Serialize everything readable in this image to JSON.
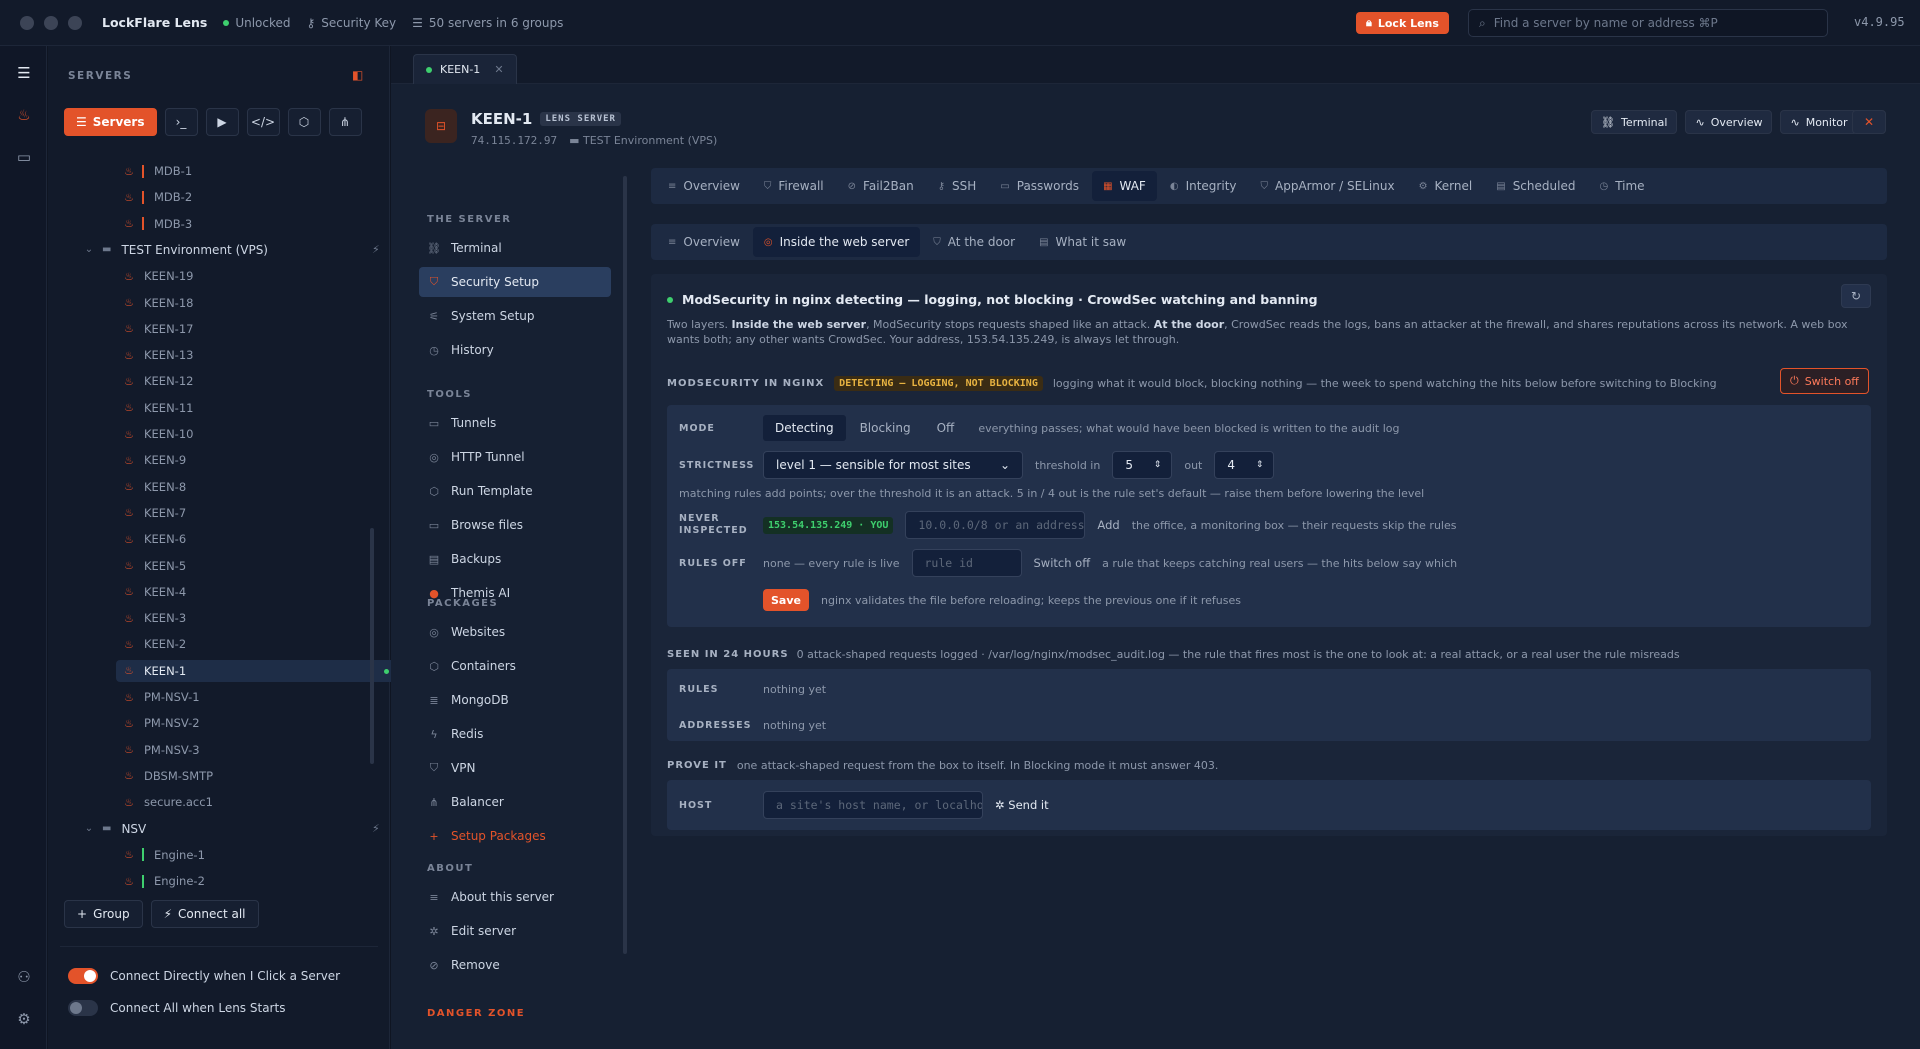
{
  "titlebar": {
    "app_name": "LockFlare Lens",
    "status": "Unlocked",
    "security_key": "Security Key",
    "servers_count": "50 servers in 6 groups",
    "lock_button": "Lock Lens",
    "search_placeholder": "Find a server by name or address ⌘P",
    "version": "v4.9.95"
  },
  "sidebar": {
    "heading": "SERVERS",
    "servers_button": "Servers",
    "group_button": "Group",
    "connect_all_button": "Connect all",
    "toggle_connect_direct": "Connect Directly when I Click a Server",
    "toggle_connect_all": "Connect All when Lens Starts",
    "toggle_connect_direct_on": true,
    "toggle_connect_all_on": false,
    "tree": [
      {
        "type": "server",
        "name": "MDB-1",
        "bar": "red"
      },
      {
        "type": "server",
        "name": "MDB-2",
        "bar": "red"
      },
      {
        "type": "server",
        "name": "MDB-3",
        "bar": "red"
      },
      {
        "type": "group",
        "name": "TEST Environment (VPS)"
      },
      {
        "type": "server",
        "name": "KEEN-19"
      },
      {
        "type": "server",
        "name": "KEEN-18"
      },
      {
        "type": "server",
        "name": "KEEN-17"
      },
      {
        "type": "server",
        "name": "KEEN-13"
      },
      {
        "type": "server",
        "name": "KEEN-12"
      },
      {
        "type": "server",
        "name": "KEEN-11"
      },
      {
        "type": "server",
        "name": "KEEN-10"
      },
      {
        "type": "server",
        "name": "KEEN-9"
      },
      {
        "type": "server",
        "name": "KEEN-8"
      },
      {
        "type": "server",
        "name": "KEEN-7"
      },
      {
        "type": "server",
        "name": "KEEN-6"
      },
      {
        "type": "server",
        "name": "KEEN-5"
      },
      {
        "type": "server",
        "name": "KEEN-4"
      },
      {
        "type": "server",
        "name": "KEEN-3"
      },
      {
        "type": "server",
        "name": "KEEN-2"
      },
      {
        "type": "server",
        "name": "KEEN-1",
        "active": true
      },
      {
        "type": "server",
        "name": "PM-NSV-1"
      },
      {
        "type": "server",
        "name": "PM-NSV-2"
      },
      {
        "type": "server",
        "name": "PM-NSV-3"
      },
      {
        "type": "server",
        "name": "DBSM-SMTP"
      },
      {
        "type": "server",
        "name": "secure.acc1"
      },
      {
        "type": "group",
        "name": "NSV"
      },
      {
        "type": "server",
        "name": "Engine-1",
        "bar": "green"
      },
      {
        "type": "server",
        "name": "Engine-2",
        "bar": "green"
      }
    ]
  },
  "tab": {
    "label": "KEEN-1"
  },
  "server": {
    "name": "KEEN-1",
    "badge": "LENS SERVER",
    "ip": "74.115.172.97",
    "env": "TEST Environment (VPS)",
    "btn_terminal": "Terminal",
    "btn_overview": "Overview",
    "btn_monitor": "Monitor"
  },
  "subnav": {
    "section_server": "THE SERVER",
    "section_tools": "TOOLS",
    "section_packages": "PACKAGES",
    "section_about": "ABOUT",
    "danger": "DANGER ZONE",
    "server_items": [
      "Terminal",
      "Security Setup",
      "System Setup",
      "History"
    ],
    "tool_items": [
      "Tunnels",
      "HTTP Tunnel",
      "Run Template",
      "Browse files",
      "Backups",
      "Themis AI"
    ],
    "package_items": [
      "Websites",
      "Containers",
      "MongoDB",
      "Redis",
      "VPN",
      "Balancer",
      "Setup Packages"
    ],
    "about_items": [
      "About this server",
      "Edit server",
      "Remove"
    ]
  },
  "tabs1": [
    "Overview",
    "Firewall",
    "Fail2Ban",
    "SSH",
    "Passwords",
    "WAF",
    "Integrity",
    "AppArmor / SELinux",
    "Kernel",
    "Scheduled",
    "Time"
  ],
  "tabs2": [
    "Overview",
    "Inside the web server",
    "At the door",
    "What it saw"
  ],
  "waf": {
    "status_title": "ModSecurity in nginx detecting — logging, not blocking · CrowdSec watching and banning",
    "intro_1": "Two layers. ",
    "intro_b1": "Inside the web server",
    "intro_2": ", ModSecurity stops requests shaped like an attack. ",
    "intro_b2": "At the door",
    "intro_3": ", CrowdSec reads the logs, bans an attacker at the firewall, and shares reputations across its network. A web box wants both; any other wants CrowdSec. Your address, 153.54.135.249, is always let through.",
    "ms_caption": "MODSECURITY IN NGINX",
    "ms_badge": "DETECTING — LOGGING, NOT BLOCKING",
    "ms_desc": "logging what it would block, blocking nothing — the week to spend watching the hits below before switching to Blocking",
    "switch_off": "Switch off",
    "mode_label": "MODE",
    "modes": [
      "Detecting",
      "Blocking",
      "Off"
    ],
    "mode_desc": "everything passes; what would have been blocked is written to the audit log",
    "strictness_label": "STRICTNESS",
    "strictness_value": "level 1 — sensible for most sites",
    "threshold_in_label": "threshold in",
    "threshold_in": "5",
    "out_label": "out",
    "threshold_out": "4",
    "strictness_help": "matching rules add points; over the threshold it is an attack. 5 in / 4 out is the rule set's default — raise them before lowering the level",
    "never_label_1": "NEVER",
    "never_label_2": "INSPECTED",
    "you_badge": "153.54.135.249 · YOU",
    "never_placeholder": "10.0.0.0/8 or an address",
    "add": "Add",
    "never_desc": "the office, a monitoring box — their requests skip the rules",
    "rules_off_label": "RULES OFF",
    "rules_off_value": "none — every rule is live",
    "rule_placeholder": "rule id",
    "switch_off_rule": "Switch off",
    "rules_off_desc": "a rule that keeps catching real users — the hits below say which",
    "save": "Save",
    "save_desc": "nginx validates the file before reloading; keeps the previous one if it refuses",
    "seen_caption": "SEEN IN 24 HOURS",
    "seen_desc": "0 attack-shaped requests logged · /var/log/nginx/modsec_audit.log — the rule that fires most is the one to look at: a real attack, or a real user the rule misreads",
    "rules_label": "RULES",
    "rules_value": "nothing yet",
    "addresses_label": "ADDRESSES",
    "addresses_value": "nothing yet",
    "prove_caption": "PROVE IT",
    "prove_desc": "one attack-shaped request from the box to itself. In Blocking mode it must answer 403.",
    "host_label": "HOST",
    "host_placeholder": "a site's host name, or localhost",
    "send": "Send it"
  },
  "colors": {
    "accent": "#e3532a",
    "ok": "#3ecf6e",
    "warn": "#e8b341"
  }
}
